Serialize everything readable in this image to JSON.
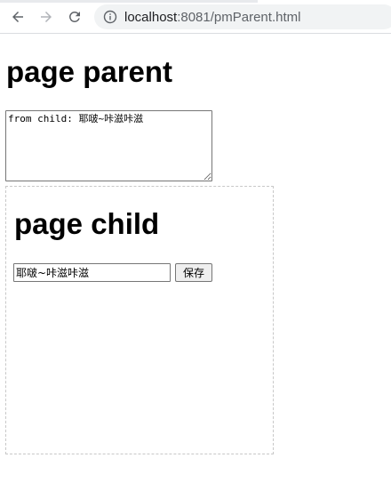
{
  "browser": {
    "url_host": "localhost",
    "url_rest": ":8081/pmParent.html"
  },
  "parent": {
    "title": "page parent",
    "message_value": "from child: 耶啵~咔滋咔滋"
  },
  "child": {
    "title": "page child",
    "input_value": "耶啵~咔滋咔滋",
    "save_label": "保存"
  },
  "colors": {
    "toolbar_border": "#dadce0",
    "omnibox_bg": "#f1f3f4",
    "frame_border": "#c8c8c8"
  },
  "icons": [
    "back-arrow-icon",
    "forward-arrow-icon",
    "reload-icon",
    "info-icon"
  ]
}
